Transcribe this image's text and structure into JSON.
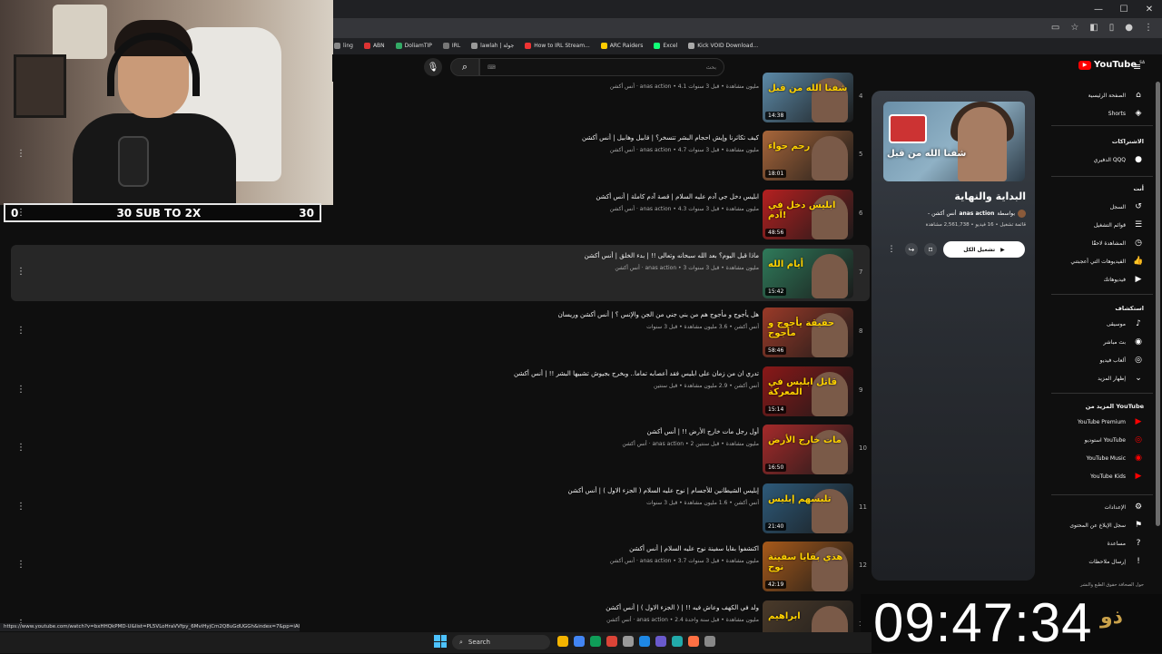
{
  "browser": {
    "window_controls": [
      "—",
      "☐",
      "✕"
    ],
    "bookmarks": [
      {
        "label": "ling",
        "color": "#888"
      },
      {
        "label": "ABN",
        "color": "#d33"
      },
      {
        "label": "DoliamTIP",
        "color": "#3a6"
      },
      {
        "label": "IRL",
        "color": "#777"
      },
      {
        "label": "lawlah | جولة",
        "color": "#999"
      },
      {
        "label": "How to IRL Stream...",
        "color": "#e33"
      },
      {
        "label": "ARC Raiders",
        "color": "#fc0"
      },
      {
        "label": "Excel",
        "color": "#1f7"
      },
      {
        "label": "Kick VOID Download...",
        "color": "#aaa"
      }
    ],
    "status_url": "https://www.youtube.com/watch?v=bxHHQkPMD-U&list=PL5VLoHraVVfpy_6MviHyjCm2Q8uGdUGGh&index=7&pp=iAQB"
  },
  "stream_overlay": {
    "goal_left": "0",
    "goal_text": "30 SUB TO 2X",
    "goal_right": "30",
    "clock": "09:47:34",
    "clock_logo": "ذو"
  },
  "youtube": {
    "logo": "YouTube",
    "logo_region": "SA",
    "search_placeholder": "بحث",
    "playlist": {
      "cover_text": "شفنا الله من قبل",
      "title": "البداية والنهاية",
      "owner_prefix": "بواسطة",
      "owner": "anas action",
      "owner_suffix": "- أنس أكشن",
      "meta_line": "قائمة تشغيل • 16 فيديو • 2,561,738 مشاهدة",
      "play_all": "تشغيل الكل"
    },
    "videos": [
      {
        "num": "4",
        "title": "",
        "meta": "أنس أكشن · anas action • 4.1 مليون مشاهدة • قبل 3 سنوات",
        "duration": "14:38",
        "thumb_text": "شفنا الله من قبل",
        "thumb_bg": "#5c8aa8"
      },
      {
        "num": "5",
        "title": "كيف تكاثرنا وإيش احجام البشر تتسخر؟ | قابيل وهابيل | أنس أكشن",
        "meta": "أنس أكشن · anas action • 4.7 مليون مشاهدة • قبل 3 سنوات",
        "duration": "18:01",
        "thumb_text": "رحم حواء",
        "thumb_bg": "#a8663a"
      },
      {
        "num": "6",
        "title": "ابليس دخل جي آدم عليه السلام | قصة آدم كاملة | أنس أكشن",
        "meta": "أنس أكشن · anas action • 4.3 مليون مشاهدة • قبل 3 سنوات",
        "duration": "48:56",
        "thumb_text": "ابليس دخل في آدم!",
        "thumb_bg": "#b52020"
      },
      {
        "num": "7",
        "title": "ماذا قبل اليوم؟ بعد الله سبحانه وتعالى !! | بدء الخلق | أنس أكشن",
        "meta": "أنس أكشن · anas action • 3 مليون مشاهدة • قبل 3 سنوات",
        "duration": "15:42",
        "thumb_text": "أيام الله",
        "thumb_bg": "#2f7a5a"
      },
      {
        "num": "8",
        "title": "هل يأجوج و مأجوج هم من بني جني من الجن والإنس ؟ | أنس أكشن وريسان",
        "meta": "أنس أكشن • 3.6 مليون مشاهدة • قبل 3 سنوات",
        "duration": "58:46",
        "thumb_text": "حقيقة يأجوج و مأجوج",
        "thumb_bg": "#9a3a28"
      },
      {
        "num": "9",
        "title": "تدري ان من زمان على ابليس فقد أعصابه تماما.. وبخرج بجيوش تشبيها البشر !! | أنس أكشن",
        "meta": "أنس أكشن • 2.9 مليون مشاهدة • قبل سنتين",
        "duration": "15:14",
        "thumb_text": "قاتل ابليس في المعركة",
        "thumb_bg": "#8a1818"
      },
      {
        "num": "10",
        "title": "أول رجل مات خارج الأرض !! | أنس أكشن",
        "meta": "أنس أكشن · anas action • 2 مليون مشاهدة • قبل سنتين",
        "duration": "16:50",
        "thumb_text": "مات خارج الأرض",
        "thumb_bg": "#a52a2a"
      },
      {
        "num": "11",
        "title": "إبليس الشيطانين للأجسام | نوح عليه السلام ( الجزء الاول ) | أنس أكشن",
        "meta": "أنس أكشن • 1.6 مليون مشاهدة • قبل 3 سنوات",
        "duration": "21:40",
        "thumb_text": "تلبسهم إبليس",
        "thumb_bg": "#2d5a7a"
      },
      {
        "num": "12",
        "title": "اكتشفوا بقايا سفينة نوح عليه السلام | أنس أكشن",
        "meta": "أنس أكشن · anas action • 3.7 مليون مشاهدة • قبل 3 سنوات",
        "duration": "42:19",
        "thumb_text": "هذي بقايا سفينة نوح",
        "thumb_bg": "#a85a1a"
      },
      {
        "num": "13",
        "title": "ولد في الكهف وعاش فيه !! | ( الجزء الاول ) | أنس أكشن",
        "meta": "أنس أكشن · anas action • 2.4 مليون مشاهدة • قبل سنة واحدة",
        "duration": "",
        "thumb_text": "ابراهيم",
        "thumb_bg": "#4a3a2a"
      }
    ],
    "sidebar": {
      "main": [
        {
          "label": "الصفحة الرئيسية",
          "icon": "home-icon",
          "glyph": "⌂"
        },
        {
          "label": "Shorts",
          "icon": "shorts-icon",
          "glyph": "◈"
        }
      ],
      "subs_head": "الاشتراكات",
      "subs": [
        {
          "label": "الدفيري QQQ",
          "icon": "channel-avatar-icon",
          "glyph": "●"
        }
      ],
      "you_head": "أنت",
      "you": [
        {
          "label": "السجل",
          "icon": "history-icon",
          "glyph": "↺"
        },
        {
          "label": "قوائم التشغيل",
          "icon": "playlists-icon",
          "glyph": "☰"
        },
        {
          "label": "المشاهدة لاحقًا",
          "icon": "watch-later-icon",
          "glyph": "◷"
        },
        {
          "label": "الفيديوهات التي أعجبتني",
          "icon": "like-icon",
          "glyph": "👍"
        },
        {
          "label": "فيديوهاتك",
          "icon": "your-videos-icon",
          "glyph": "▶"
        }
      ],
      "explore_head": "استكشاف",
      "explore": [
        {
          "label": "موسيقى",
          "icon": "music-icon",
          "glyph": "♪"
        },
        {
          "label": "بث مباشر",
          "icon": "live-icon",
          "glyph": "◉"
        },
        {
          "label": "ألعاب فيديو",
          "icon": "gaming-icon",
          "glyph": "◎"
        },
        {
          "label": "إظهار المزيد",
          "icon": "chevron-down-icon",
          "glyph": "⌄"
        }
      ],
      "more_head": "المزيد من YouTube",
      "more": [
        {
          "label": "YouTube Premium",
          "icon": "yt-premium-icon",
          "glyph": "▶"
        },
        {
          "label": "استوديو YouTube",
          "icon": "yt-studio-icon",
          "glyph": "◎"
        },
        {
          "label": "YouTube Music",
          "icon": "yt-music-icon",
          "glyph": "◉"
        },
        {
          "label": "YouTube Kids",
          "icon": "yt-kids-icon",
          "glyph": "▶"
        }
      ],
      "settings": [
        {
          "label": "الإعدادات",
          "icon": "settings-icon",
          "glyph": "⚙"
        },
        {
          "label": "سجل الإبلاغ عن المحتوى",
          "icon": "flag-icon",
          "glyph": "⚑"
        },
        {
          "label": "مساعدة",
          "icon": "help-icon",
          "glyph": "?"
        },
        {
          "label": "إرسال ملاحظات",
          "icon": "feedback-icon",
          "glyph": "!"
        }
      ],
      "footer": "حول  الصحافة  حقوق الطبع والنشر"
    }
  },
  "taskbar": {
    "search_label": "Search",
    "apps": [
      "#f4b400",
      "#4285f4",
      "#0f9d58",
      "#db4437",
      "#999",
      "#1e88e5",
      "#6a5acd",
      "#2aa",
      "#ff7043",
      "#888"
    ]
  }
}
